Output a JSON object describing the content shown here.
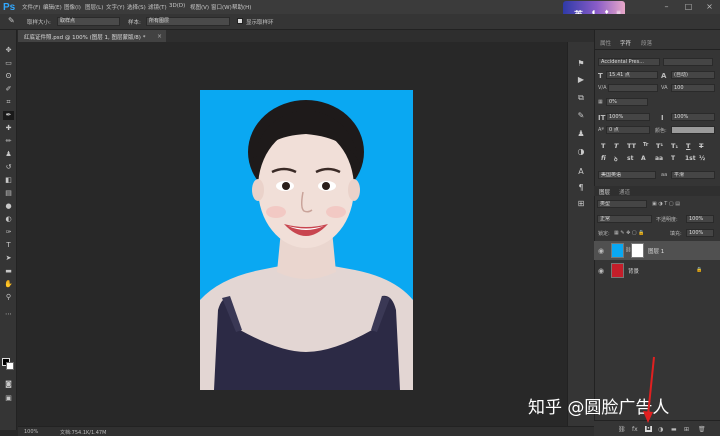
{
  "app": {
    "logo": "Ps"
  },
  "menu": [
    "文件(F)",
    "编辑(E)",
    "图像(I)",
    "图层(L)",
    "文字(Y)",
    "选择(S)",
    "滤镜(T)",
    "3D(D)",
    "视图(V)",
    "窗口(W)",
    "帮助(H)"
  ],
  "ime": {
    "label": "英"
  },
  "options": {
    "sample_size_label": "取样大小:",
    "sample_size_value": "取样点",
    "sample_label": "样本:",
    "sample_value": "所有图层",
    "show_ring_label": "显示取样环"
  },
  "document": {
    "tab_title": "红底证件照.psd @ 100% (图层 1, 图层蒙版/8) *"
  },
  "status": {
    "zoom": "100%",
    "doc_info": "文档:754.1K/1.47M"
  },
  "character_panel": {
    "tabs": [
      "属性",
      "字符",
      "段落"
    ],
    "active_tab": "字符",
    "font_family": "Accidental Pres...",
    "font_size": "15.41 点",
    "leading": "(自动)",
    "kerning_label": "V/A",
    "tracking": "100",
    "scale_pct": "0%",
    "vertical_scale": "100%",
    "horizontal_scale": "100%",
    "baseline_shift": "0 点",
    "color_label": "颜色:",
    "language": "美国英语",
    "antialias": "平滑"
  },
  "layers_panel": {
    "tabs": [
      "图层",
      "通道"
    ],
    "active_tab": "图层",
    "filter_kind": "类型",
    "blend_mode": "正常",
    "opacity_label": "不透明度:",
    "opacity": "100%",
    "lock_label": "锁定:",
    "fill_label": "填充:",
    "fill": "100%",
    "layers": [
      {
        "name": "图层 1",
        "selected": true
      },
      {
        "name": "背景",
        "selected": false
      }
    ]
  },
  "watermark": "知乎 @圆脸广告人",
  "colors": {
    "accent": "#31a8ff",
    "photo_background": "#0aa8f2",
    "arrow": "#e02020"
  }
}
